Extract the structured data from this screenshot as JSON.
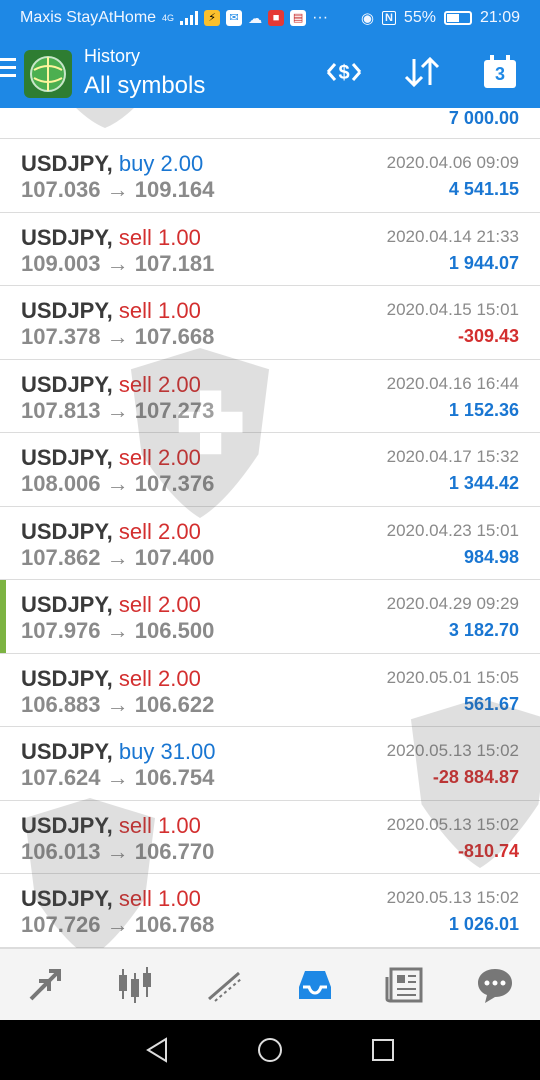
{
  "status_bar": {
    "carrier": "Maxis StayAtHome",
    "network": "4G",
    "battery": "55%",
    "battery_level": 0.55,
    "time": "21:09"
  },
  "header": {
    "subtitle": "History",
    "title": "All symbols",
    "calendar_day": "3"
  },
  "colors": {
    "app_bar": "#1e88e5",
    "buy": "#1976d2",
    "sell": "#d32f2f",
    "profit_positive": "#1976d2",
    "profit_negative": "#d32f2f",
    "selected_marker": "#7cb342"
  },
  "trades_partial_top": {
    "profit": "7 000.00"
  },
  "trades": [
    {
      "symbol": "USDJPY,",
      "side": "buy",
      "volume": "2.00",
      "open": "107.036",
      "close": "109.164",
      "time": "2020.04.06 09:09",
      "profit": "4 541.15",
      "positive": true
    },
    {
      "symbol": "USDJPY,",
      "side": "sell",
      "volume": "1.00",
      "open": "109.003",
      "close": "107.181",
      "time": "2020.04.14 21:33",
      "profit": "1 944.07",
      "positive": true
    },
    {
      "symbol": "USDJPY,",
      "side": "sell",
      "volume": "1.00",
      "open": "107.378",
      "close": "107.668",
      "time": "2020.04.15 15:01",
      "profit": "-309.43",
      "positive": false
    },
    {
      "symbol": "USDJPY,",
      "side": "sell",
      "volume": "2.00",
      "open": "107.813",
      "close": "107.273",
      "time": "2020.04.16 16:44",
      "profit": "1 152.36",
      "positive": true
    },
    {
      "symbol": "USDJPY,",
      "side": "sell",
      "volume": "2.00",
      "open": "108.006",
      "close": "107.376",
      "time": "2020.04.17 15:32",
      "profit": "1 344.42",
      "positive": true
    },
    {
      "symbol": "USDJPY,",
      "side": "sell",
      "volume": "2.00",
      "open": "107.862",
      "close": "107.400",
      "time": "2020.04.23 15:01",
      "profit": "984.98",
      "positive": true
    },
    {
      "symbol": "USDJPY,",
      "side": "sell",
      "volume": "2.00",
      "open": "107.976",
      "close": "106.500",
      "time": "2020.04.29 09:29",
      "profit": "3 182.70",
      "positive": true,
      "selected": true
    },
    {
      "symbol": "USDJPY,",
      "side": "sell",
      "volume": "2.00",
      "open": "106.883",
      "close": "106.622",
      "time": "2020.05.01 15:05",
      "profit": "561.67",
      "positive": true
    },
    {
      "symbol": "USDJPY,",
      "side": "buy",
      "volume": "31.00",
      "open": "107.624",
      "close": "106.754",
      "time": "2020.05.13 15:02",
      "profit": "-28 884.87",
      "positive": false
    },
    {
      "symbol": "USDJPY,",
      "side": "sell",
      "volume": "1.00",
      "open": "106.013",
      "close": "106.770",
      "time": "2020.05.13 15:02",
      "profit": "-810.74",
      "positive": false
    },
    {
      "symbol": "USDJPY,",
      "side": "sell",
      "volume": "1.00",
      "open": "107.726",
      "close": "106.768",
      "time": "2020.05.13 15:02",
      "profit": "1 026.01",
      "positive": true
    }
  ],
  "bottom_nav": [
    {
      "name": "quotes",
      "icon": "trade-arrows-icon",
      "active": false
    },
    {
      "name": "chart",
      "icon": "candlestick-chart-icon",
      "active": false
    },
    {
      "name": "trade",
      "icon": "trend-line-icon",
      "active": false
    },
    {
      "name": "history",
      "icon": "inbox-tray-icon",
      "active": true
    },
    {
      "name": "news",
      "icon": "newspaper-icon",
      "active": false
    },
    {
      "name": "messages",
      "icon": "chat-bubble-icon",
      "active": false
    }
  ],
  "arrow_glyph": "→"
}
